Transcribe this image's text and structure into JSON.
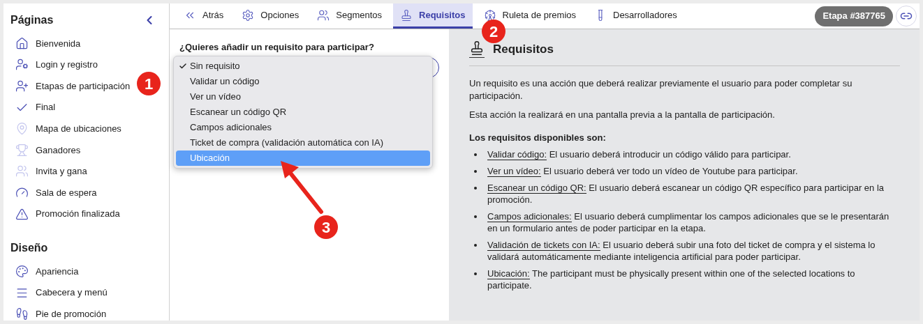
{
  "sidebar": {
    "sections": [
      {
        "title": "Páginas",
        "items": [
          {
            "label": "Bienvenida",
            "dimmed": false
          },
          {
            "label": "Login y registro",
            "dimmed": false
          },
          {
            "label": "Etapas de participación",
            "dimmed": false
          },
          {
            "label": "Final",
            "dimmed": false
          },
          {
            "label": "Mapa de ubicaciones",
            "dimmed": true
          },
          {
            "label": "Ganadores",
            "dimmed": true
          },
          {
            "label": "Invita y gana",
            "dimmed": true
          },
          {
            "label": "Sala de espera",
            "dimmed": false
          },
          {
            "label": "Promoción finalizada",
            "dimmed": false
          }
        ]
      },
      {
        "title": "Diseño",
        "items": [
          {
            "label": "Apariencia",
            "dimmed": false
          },
          {
            "label": "Cabecera y menú",
            "dimmed": false
          },
          {
            "label": "Pie de promoción",
            "dimmed": false
          }
        ]
      }
    ]
  },
  "tabs": [
    {
      "label": "Atrás",
      "selected": false
    },
    {
      "label": "Opciones",
      "selected": false
    },
    {
      "label": "Segmentos",
      "selected": false
    },
    {
      "label": "Requisitos",
      "selected": true
    },
    {
      "label": "Ruleta de premios",
      "selected": false
    },
    {
      "label": "Desarrolladores",
      "selected": false
    }
  ],
  "stage_badge": "Etapa #387765",
  "form": {
    "label": "¿Quieres añadir un requisito para participar?",
    "options": [
      {
        "label": "Sin requisito",
        "checked": true,
        "selected": false
      },
      {
        "label": "Validar un código",
        "checked": false,
        "selected": false
      },
      {
        "label": "Ver un vídeo",
        "checked": false,
        "selected": false
      },
      {
        "label": "Escanear un código QR",
        "checked": false,
        "selected": false
      },
      {
        "label": "Campos adicionales",
        "checked": false,
        "selected": false
      },
      {
        "label": "Ticket de compra (validación automática con IA)",
        "checked": false,
        "selected": false
      },
      {
        "label": "Ubicación",
        "checked": false,
        "selected": true
      }
    ]
  },
  "help": {
    "title": "Requisitos",
    "paragraphs": [
      "Un requisito es una acción que deberá realizar previamente el usuario para poder completar su participación.",
      "Esta acción la realizará en una pantalla previa a la pantalla de participación."
    ],
    "list_title": "Los requisitos disponibles son:",
    "items": [
      {
        "term": "Validar código:",
        "text": "El usuario deberá introducir un código válido para participar."
      },
      {
        "term": "Ver un vídeo:",
        "text": "El usuario deberá ver todo un vídeo de Youtube para participar."
      },
      {
        "term": "Escanear un código QR:",
        "text": "El usuario deberá escanear un código QR específico para participar en la promoción."
      },
      {
        "term": "Campos adicionales:",
        "text": "El usuario deberá cumplimentar los campos adicionales que se le presentarán en un formulario antes de poder participar en la etapa."
      },
      {
        "term": "Validación de tickets con IA:",
        "text": "El usuario deberá subir una foto del ticket de compra y el sistema lo validará automáticamente mediante inteligencia artificial para poder participar."
      },
      {
        "term": "Ubicación:",
        "text": "The participant must be physically present within one of the selected locations to participate."
      }
    ]
  },
  "markers": [
    "1",
    "2",
    "3"
  ]
}
